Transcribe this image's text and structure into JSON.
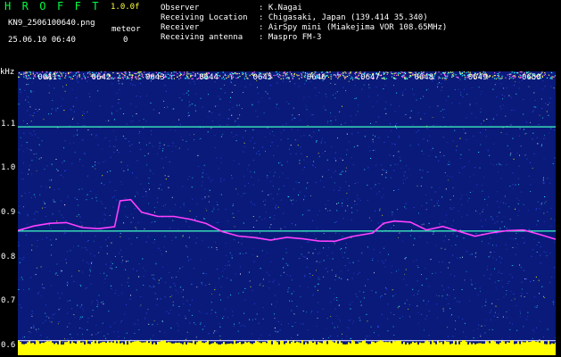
{
  "header": {
    "program_title": "H R O F F T",
    "version": "1.0.0f",
    "filename": "KN9_2506100640.png",
    "meteor_label": "meteor",
    "meteor_count": "0",
    "datetime": "25.06.10 06:40"
  },
  "station_info": [
    {
      "label": "Observer",
      "value": ": K.Nagai"
    },
    {
      "label": "Receiving Location",
      "value": ": Chigasaki, Japan (139.414 35.340)"
    },
    {
      "label": "Receiver",
      "value": ": AirSpy mini (Miakejima VOR 108.65MHz)"
    },
    {
      "label": "Receiving antenna",
      "value": ": Maspro FM-3"
    }
  ],
  "chart_data": {
    "type": "heatmap",
    "ylabel": "kHz",
    "y_ticks": [
      "1.1",
      "1.0",
      "0.9",
      "0.8",
      "0.7",
      "0.6"
    ],
    "y_tick_values": [
      1.1,
      1.0,
      0.9,
      0.8,
      0.7,
      0.6
    ],
    "x_ticks": [
      "0641",
      "0642",
      "0643",
      "0644",
      "0645",
      "0646",
      "0647",
      "0648",
      "0649",
      "0650"
    ],
    "ylim": [
      0.58,
      1.22
    ],
    "horizontal_lines_khz": [
      1.095,
      0.86,
      0.613
    ],
    "trace_khz": [
      [
        0.0,
        0.86
      ],
      [
        0.03,
        0.87
      ],
      [
        0.06,
        0.875
      ],
      [
        0.09,
        0.88
      ],
      [
        0.12,
        0.87
      ],
      [
        0.15,
        0.865
      ],
      [
        0.18,
        0.87
      ],
      [
        0.19,
        0.93
      ],
      [
        0.21,
        0.93
      ],
      [
        0.23,
        0.9
      ],
      [
        0.26,
        0.895
      ],
      [
        0.29,
        0.89
      ],
      [
        0.32,
        0.885
      ],
      [
        0.35,
        0.875
      ],
      [
        0.38,
        0.86
      ],
      [
        0.41,
        0.85
      ],
      [
        0.44,
        0.845
      ],
      [
        0.47,
        0.84
      ],
      [
        0.5,
        0.845
      ],
      [
        0.53,
        0.84
      ],
      [
        0.56,
        0.84
      ],
      [
        0.59,
        0.835
      ],
      [
        0.62,
        0.845
      ],
      [
        0.66,
        0.855
      ],
      [
        0.68,
        0.88
      ],
      [
        0.7,
        0.885
      ],
      [
        0.73,
        0.88
      ],
      [
        0.76,
        0.865
      ],
      [
        0.79,
        0.87
      ],
      [
        0.82,
        0.86
      ],
      [
        0.85,
        0.85
      ],
      [
        0.88,
        0.855
      ],
      [
        0.91,
        0.86
      ],
      [
        0.94,
        0.865
      ],
      [
        0.97,
        0.855
      ],
      [
        1.0,
        0.84
      ]
    ],
    "colors": {
      "background": "#0a1a7a",
      "noise_cyan": "#20ffff",
      "noise_yellow": "#ffff00",
      "trace": "#ff40ff",
      "line": "#40ffc0",
      "bottom_band": "#ffff00"
    }
  }
}
